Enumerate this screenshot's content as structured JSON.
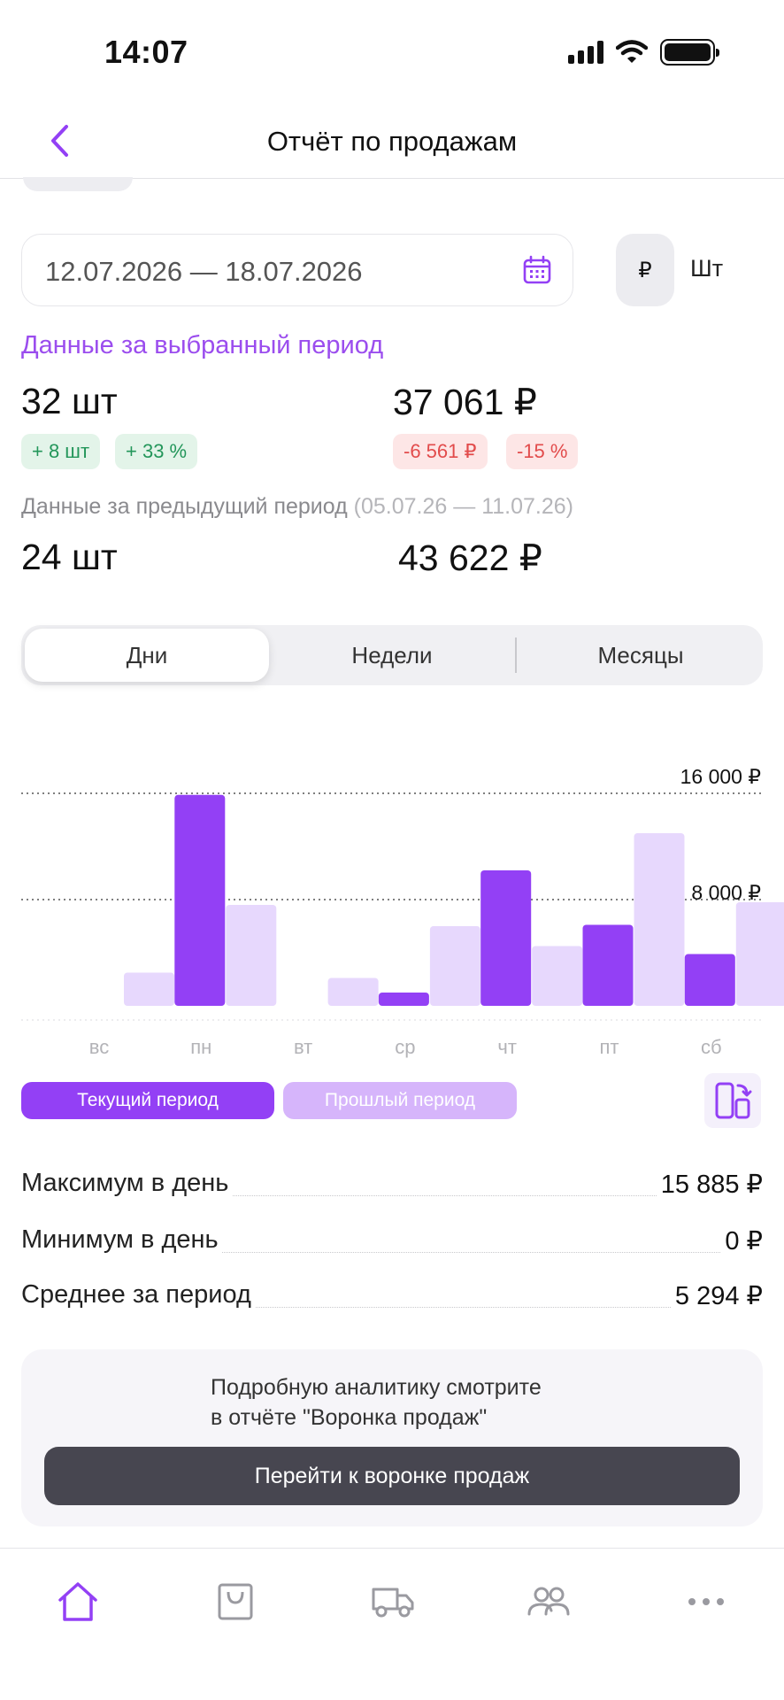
{
  "status_bar": {
    "time": "14:07"
  },
  "header": {
    "title": "Отчёт по продажам"
  },
  "filters": {
    "date_range": "12.07.2026 — 18.07.2026",
    "unit_rub": "₽",
    "unit_sht": "Шт"
  },
  "current_period": {
    "label": "Данные за выбранный период",
    "qty": "32 шт",
    "sum": "37 061 ₽",
    "qty_delta": "+ 8 шт",
    "qty_delta_pct": "+ 33 %",
    "sum_delta": "-6 561 ₽",
    "sum_delta_pct": "-15 %"
  },
  "previous_period": {
    "label": "Данные за предыдущий период",
    "range": "(05.07.26 — 11.07.26)",
    "qty": "24 шт",
    "sum": "43 622 ₽"
  },
  "segmented": {
    "days": "Дни",
    "weeks": "Недели",
    "months": "Месяцы",
    "active": "days"
  },
  "chart_data": {
    "type": "bar",
    "categories": [
      "вс",
      "пн",
      "вт",
      "ср",
      "чт",
      "пт",
      "сб"
    ],
    "series": [
      {
        "name": "Текущий период",
        "values": [
          0,
          15885,
          0,
          1000,
          10200,
          6100,
          3900
        ]
      },
      {
        "name": "Прошлый период",
        "values": [
          2500,
          7600,
          2100,
          6000,
          4500,
          13000,
          7800
        ]
      }
    ],
    "ytick_labels": [
      "16 000 ₽",
      "8 000 ₽"
    ],
    "ylim": [
      0,
      16000
    ],
    "colors": {
      "current": "#9340f5",
      "previous": "#e7d8fd"
    }
  },
  "legend": {
    "current": "Текущий период",
    "previous": "Прошлый период"
  },
  "stats": {
    "max_label": "Максимум в день",
    "max_value": "15 885 ₽",
    "min_label": "Минимум в день",
    "min_value": "0 ₽",
    "avg_label": "Среднее за период",
    "avg_value": "5 294 ₽"
  },
  "cta": {
    "text_line1": "Подробную аналитику смотрите",
    "text_line2": "в отчёте \"Воронка продаж\"",
    "button": "Перейти к воронке продаж"
  },
  "tabs": [
    {
      "icon": "home-icon",
      "active": true
    },
    {
      "icon": "shopping-bag-icon",
      "active": false
    },
    {
      "icon": "truck-icon",
      "active": false
    },
    {
      "icon": "users-icon",
      "active": false
    },
    {
      "icon": "more-icon",
      "active": false
    }
  ],
  "colors": {
    "accent": "#9340f5",
    "accent_light": "#d6b5fb",
    "up": "#23965a",
    "down": "#e24b4b"
  }
}
